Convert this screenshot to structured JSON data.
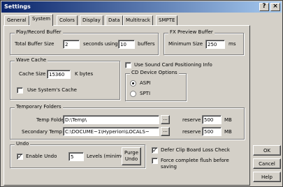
{
  "window": {
    "title": "Settings",
    "help_glyph": "?",
    "close_glyph": "×"
  },
  "tabs": [
    {
      "label": "General",
      "active": false
    },
    {
      "label": "System",
      "active": true
    },
    {
      "label": "Colors",
      "active": false
    },
    {
      "label": "Display",
      "active": false
    },
    {
      "label": "Data",
      "active": false
    },
    {
      "label": "Multitrack",
      "active": false
    },
    {
      "label": "SMPTE",
      "active": false
    }
  ],
  "play_record_buffer": {
    "legend": "Play/Record Buffer",
    "total_buffer_size_label": "Total Buffer Size",
    "total_buffer_size_value": "2",
    "seconds_using_label": "seconds using",
    "buffers_value": "10",
    "buffers_label": "buffers"
  },
  "fx_preview_buffer": {
    "legend": "FX Preview Buffer",
    "minimum_size_label": "Minimum Size",
    "minimum_size_value": "250",
    "unit": "ms"
  },
  "wave_cache": {
    "legend": "Wave Cache",
    "cache_size_label": "Cache Size",
    "cache_size_value": "15360",
    "cache_size_unit": "K bytes",
    "use_system_cache_label": "Use System's Cache",
    "use_system_cache_checked": false
  },
  "sound_card": {
    "use_positioning_info_label": "Use Sound Card Positioning Info",
    "use_positioning_info_checked": false
  },
  "cd_device_options": {
    "legend": "CD Device Options",
    "options": [
      {
        "label": "ASPI",
        "selected": true
      },
      {
        "label": "SPTI",
        "selected": false
      }
    ]
  },
  "temporary_folders": {
    "legend": "Temporary Folders",
    "temp_folder_label": "Temp Folder",
    "temp_folder_value": "D:\\Temp\\",
    "temp_folder_browse": "...",
    "temp_folder_reserve_label": "reserve",
    "temp_folder_reserve_value": "500",
    "temp_folder_reserve_unit": "MB",
    "secondary_temp_label": "Secondary Temp",
    "secondary_temp_value": "C:\\DOCUME~1\\Hyperion\\LOCALS~",
    "secondary_temp_browse": "...",
    "secondary_temp_reserve_label": "reserve",
    "secondary_temp_reserve_value": "500",
    "secondary_temp_reserve_unit": "MB"
  },
  "undo": {
    "legend": "Undo",
    "enable_undo_label": "Enable Undo",
    "enable_undo_checked": true,
    "levels_value": "5",
    "levels_label": "Levels (minimum)",
    "purge_undo_label_line1": "Purge",
    "purge_undo_label_line2": "Undo"
  },
  "options": {
    "defer_label": "Defer Clip Board Loss Check",
    "defer_checked": true,
    "force_flush_label_line1": "Force complete flush before",
    "force_flush_label_line2": "saving",
    "force_flush_checked": false
  },
  "buttons": {
    "ok": "OK",
    "cancel": "Cancel",
    "help": "Help"
  }
}
